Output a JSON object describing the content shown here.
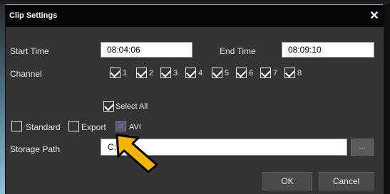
{
  "dialog": {
    "title": "Clip Settings",
    "close_icon": "close-icon"
  },
  "time": {
    "start_label": "Start Time",
    "start_value": "08:04:06",
    "end_label": "End Time",
    "end_value": "08:09:10"
  },
  "channel": {
    "label": "Channel",
    "items": [
      {
        "label": "1",
        "checked": true
      },
      {
        "label": "2",
        "checked": true
      },
      {
        "label": "3",
        "checked": true
      },
      {
        "label": "4",
        "checked": true
      },
      {
        "label": "5",
        "checked": true
      },
      {
        "label": "6",
        "checked": true
      },
      {
        "label": "7",
        "checked": true
      },
      {
        "label": "8",
        "checked": true
      }
    ]
  },
  "select_all": {
    "label": "Select All",
    "checked": true
  },
  "formats": {
    "standard_label": "Standard",
    "export_label": "Export",
    "avi_label": "AVI"
  },
  "storage": {
    "label": "Storage Path",
    "value": "C:\\C",
    "browse_label": "..."
  },
  "buttons": {
    "ok": "OK",
    "cancel": "Cancel"
  },
  "colors": {
    "dialog_bg": "#343434",
    "titlebar_bg": "#070707",
    "arrow_fill": "#f5b400"
  }
}
